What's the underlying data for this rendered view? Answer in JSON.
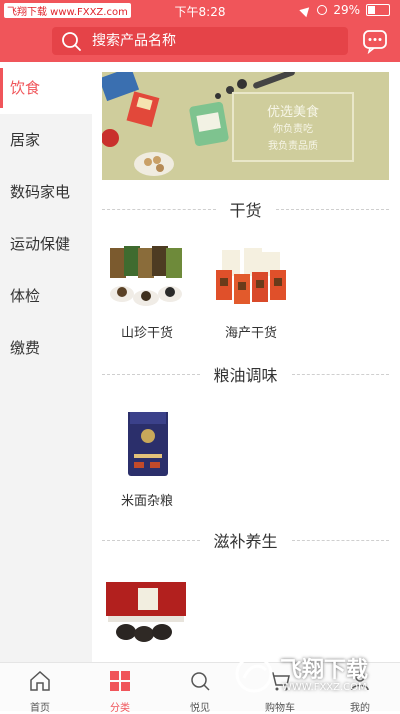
{
  "status_bar": {
    "carrier": "飞翔下载 www.FXXZ.com",
    "time": "下午8:28",
    "battery": "29%"
  },
  "search": {
    "placeholder": "搜索产品名称"
  },
  "sidebar": {
    "items": [
      {
        "label": "饮食",
        "active": true
      },
      {
        "label": "居家"
      },
      {
        "label": "数码家电"
      },
      {
        "label": "运动保健"
      },
      {
        "label": "体检"
      },
      {
        "label": "缴费"
      }
    ]
  },
  "banner": {
    "title": "优选美食",
    "line1": "你负责吃",
    "line2": "我负责品质"
  },
  "sections": [
    {
      "title": "干货",
      "products": [
        {
          "label": "山珍干货"
        },
        {
          "label": "海产干货"
        }
      ]
    },
    {
      "title": "粮油调味",
      "products": [
        {
          "label": "米面杂粮"
        }
      ]
    },
    {
      "title": "滋补养生",
      "products": [
        {
          "label": ""
        }
      ]
    }
  ],
  "bottom_nav": [
    {
      "label": "首页",
      "icon": "home-icon"
    },
    {
      "label": "分类",
      "icon": "category-icon",
      "active": true
    },
    {
      "label": "悦见",
      "icon": "discover-icon"
    },
    {
      "label": "购物车",
      "icon": "cart-icon"
    },
    {
      "label": "我的",
      "icon": "profile-icon"
    }
  ],
  "watermark": {
    "name": "飞翔下载",
    "url": "WWW.FXXZ.COM"
  },
  "colors": {
    "brand": "#f0555a",
    "sidebar_bg": "#f3f3f3"
  }
}
